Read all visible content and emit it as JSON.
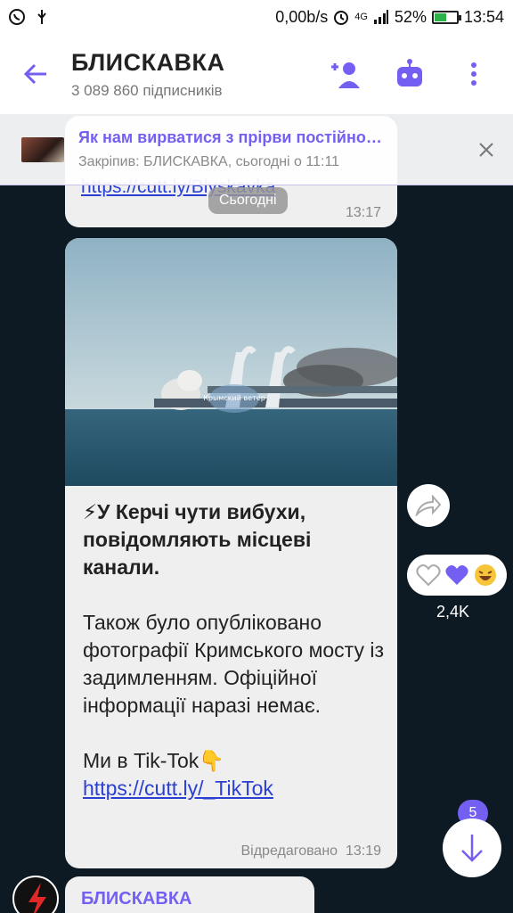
{
  "status_bar": {
    "speed": "0,00b/s",
    "network": "4G",
    "battery": "52%",
    "time": "13:54"
  },
  "header": {
    "title": "БЛИСКАВКА",
    "subscribers": "3 089 860 підписників"
  },
  "pinned": {
    "title": "Як нам вирватися з прірви постійно…",
    "meta": "Закріпив: БЛИСКАВКА, сьогодні о 11:11"
  },
  "previous_message": {
    "link": "https://cutt.ly/Blyskavka",
    "time": "13:17"
  },
  "date_divider": "Сьогодні",
  "message": {
    "headline": "⚡У Керчі чути вибухи, повідомляють місцеві канали.",
    "body": "Також було опубліковано фотографії Кримського мосту із задимленням. Офіційної інформації наразі немає.",
    "tiktok_text": "Ми в Tik-Tok👇",
    "tiktok_link": "https://cutt.ly/_TikTok",
    "edited_label": "Відредаговано",
    "time": "13:19",
    "photo_watermark": "Крымский ветер"
  },
  "reactions": {
    "count": "2,4K"
  },
  "scroll": {
    "unread_badge": "5"
  },
  "next_message": {
    "sender": "БЛИСКАВКА"
  },
  "colors": {
    "accent": "#7360f2",
    "chat_bg": "#0d1a23",
    "bubble": "#efefef",
    "link": "#2a3fd4"
  }
}
